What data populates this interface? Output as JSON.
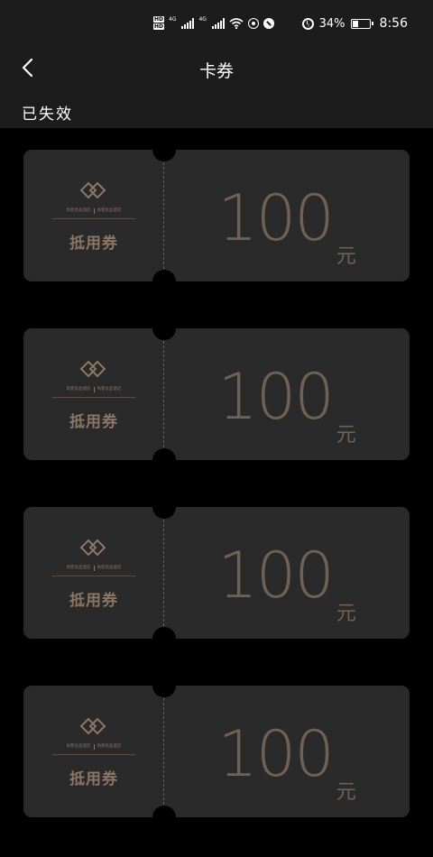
{
  "status_bar": {
    "hd_labels": [
      "HD",
      "HD"
    ],
    "signal_tags": [
      "4G",
      "4G"
    ],
    "battery_percent": "34%",
    "battery_level": 0.34,
    "time": "8:56"
  },
  "header": {
    "title": "卡券"
  },
  "section": {
    "title": "已失效"
  },
  "coupons": [
    {
      "brand_left": "尚客优品酒店",
      "brand_right": "尚客优品酒店",
      "label": "抵用券",
      "amount": "100",
      "unit": "元"
    },
    {
      "brand_left": "尚客优品酒店",
      "brand_right": "尚客优品酒店",
      "label": "抵用券",
      "amount": "100",
      "unit": "元"
    },
    {
      "brand_left": "尚客优品酒店",
      "brand_right": "尚客优品酒店",
      "label": "抵用券",
      "amount": "100",
      "unit": "元"
    },
    {
      "brand_left": "尚客优品酒店",
      "brand_right": "尚客优品酒店",
      "label": "抵用券",
      "amount": "100",
      "unit": "元"
    }
  ],
  "colors": {
    "background": "#000000",
    "header": "#1c1c1c",
    "coupon": "#2a2a2a",
    "accent": "#8c7766"
  }
}
